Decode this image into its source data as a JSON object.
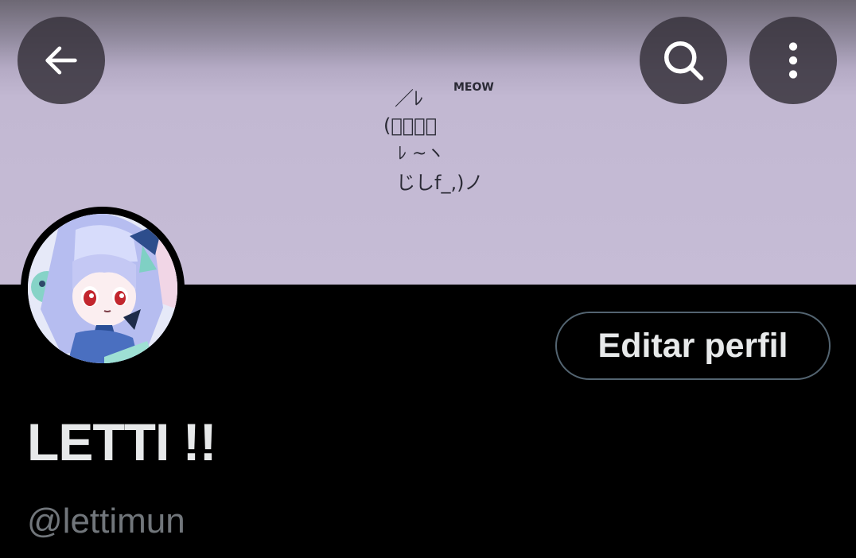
{
  "header": {
    "back_icon": "arrow-left-icon",
    "search_icon": "search-icon",
    "more_icon": "more-vertical-icon"
  },
  "banner": {
    "art_lines": [
      "／ﾚ",
      "(ﾟ､｡７",
      "ﾚ ~ヽ",
      "じしf_,)ノ"
    ],
    "art_caption": "MEOW",
    "background_color": "#c6bcd6"
  },
  "profile": {
    "edit_button_label": "Editar perfil",
    "display_name": "LETTI !!",
    "handle": "@lettimun"
  },
  "colors": {
    "background": "#000000",
    "primary_text": "#e7e9ea",
    "secondary_text": "#71767b",
    "button_border": "#536471"
  }
}
